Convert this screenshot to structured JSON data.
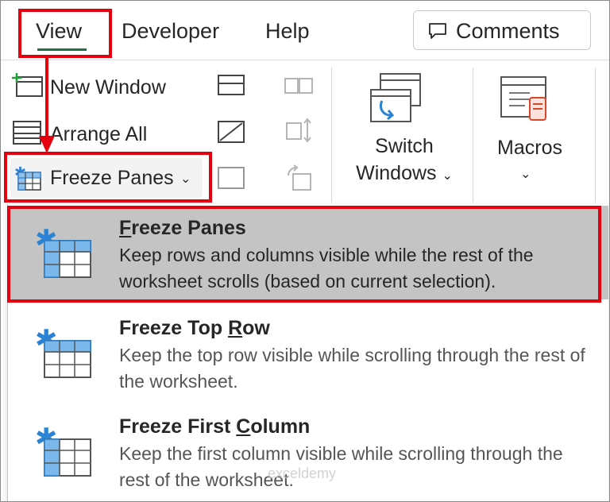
{
  "tabs": [
    {
      "label": "View"
    },
    {
      "label": "Developer"
    },
    {
      "label": "Help"
    }
  ],
  "comments_button": {
    "label": "Comments"
  },
  "ribbon": {
    "new_window": "New Window",
    "arrange_all": "Arrange All",
    "freeze_panes_button": "Freeze Panes",
    "switch_windows": {
      "line1": "Switch",
      "line2": "Windows"
    },
    "macros": "Macros"
  },
  "menu": {
    "items": [
      {
        "title_first": "F",
        "title_rest": "reeze Panes",
        "description": "Keep rows and columns visible while the rest of the worksheet scrolls (based on current selection).",
        "highlighted": true,
        "icon": "freeze-panes-icon"
      },
      {
        "title_first": "Freeze Top ",
        "title_under": "R",
        "title_rest": "ow",
        "description": "Keep the top row visible while scrolling through the rest of the worksheet.",
        "icon": "freeze-top-row-icon"
      },
      {
        "title_first": "Freeze First ",
        "title_under": "C",
        "title_rest": "olumn",
        "description": "Keep the first column visible while scrolling through the rest of the worksheet.",
        "icon": "freeze-first-column-icon"
      }
    ]
  },
  "watermark": "exceldemy",
  "colors": {
    "annotation_red": "#e4000f",
    "accent_green": "#1e7145",
    "icon_blue": "#2b83d6"
  }
}
